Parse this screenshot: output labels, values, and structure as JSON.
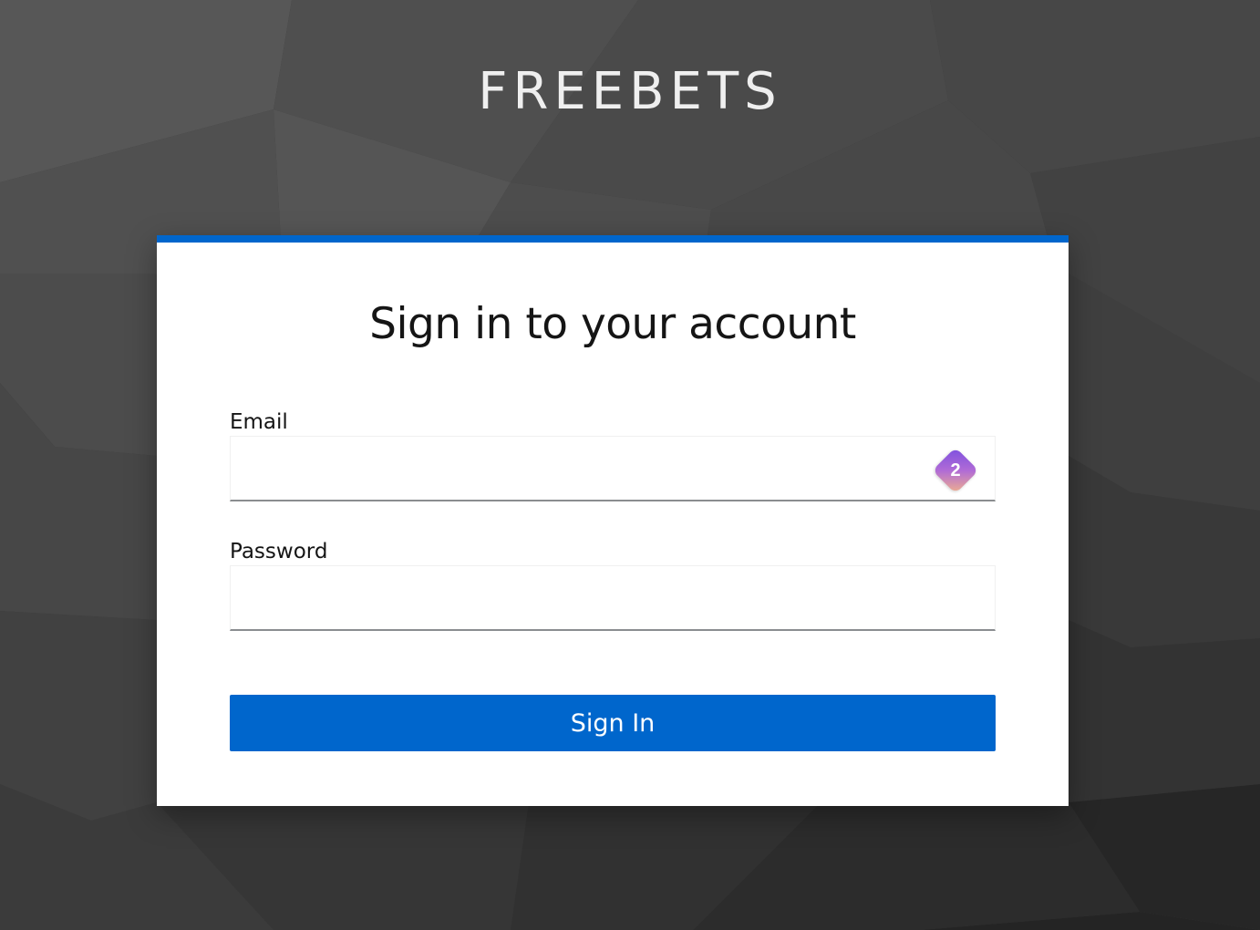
{
  "brand": {
    "name": "FREEBETS"
  },
  "login": {
    "title": "Sign in to your account",
    "email_label": "Email",
    "email_value": "",
    "password_label": "Password",
    "password_value": "",
    "submit_label": "Sign In"
  },
  "password_manager": {
    "badge_count": "2",
    "icon": "password-manager-icon"
  },
  "colors": {
    "accent": "#0066cc",
    "background": "#3d3d3d",
    "card": "#ffffff",
    "text": "#151515"
  }
}
